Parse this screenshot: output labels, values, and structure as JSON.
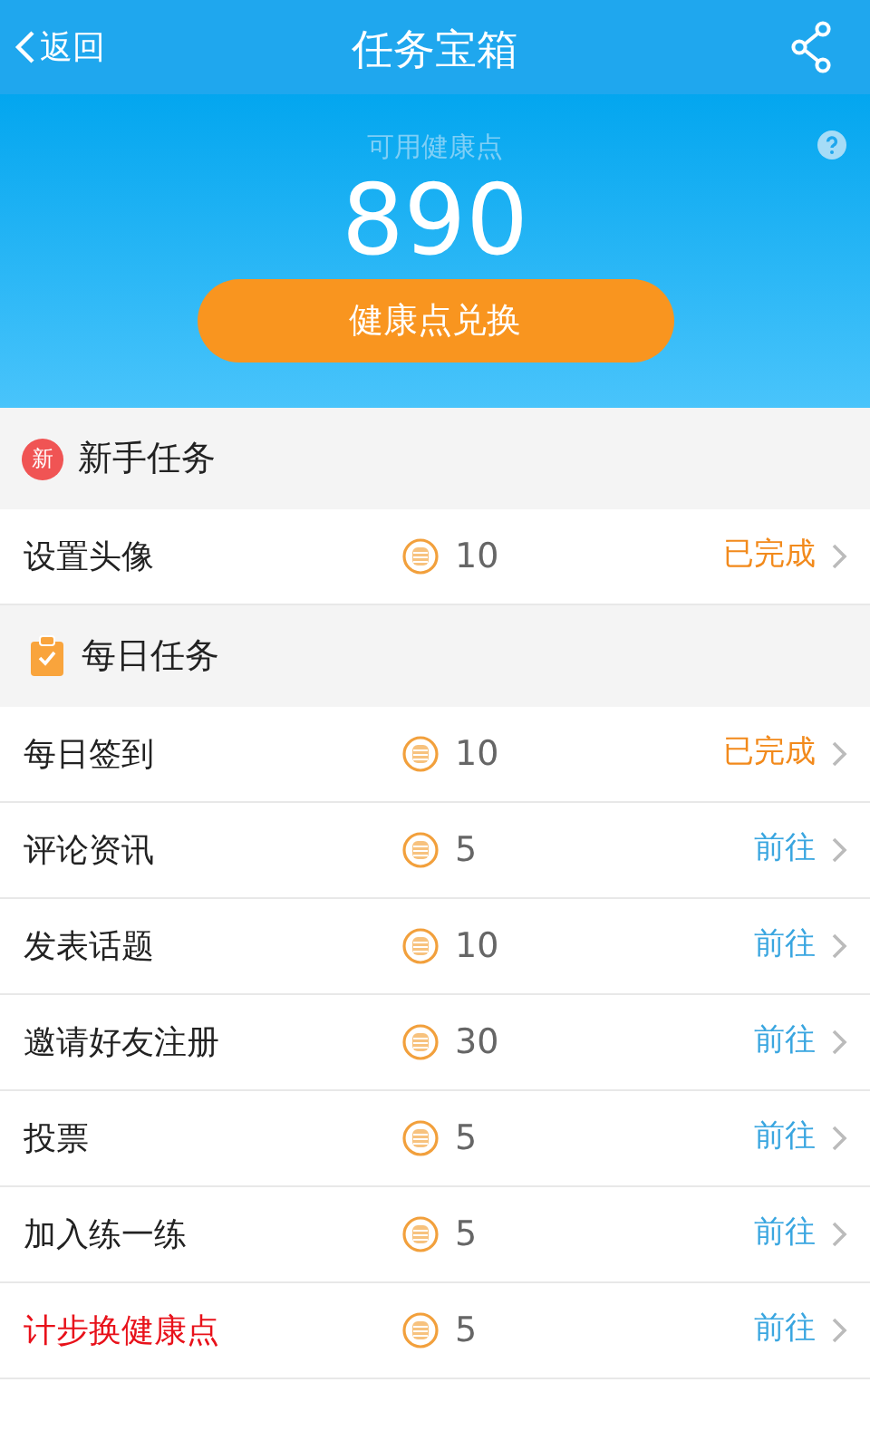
{
  "header": {
    "back": "返回",
    "title": "任务宝箱"
  },
  "balance": {
    "label": "可用健康点",
    "value": "890",
    "button": "健康点兑换"
  },
  "sections": [
    {
      "title": "新手任务",
      "kind": "badge",
      "badge": "新",
      "tasks": [
        {
          "name": "设置头像",
          "points": "10",
          "status": "已完成",
          "kind": "done",
          "highlight": false
        }
      ]
    },
    {
      "title": "每日任务",
      "kind": "clipboard",
      "tasks": [
        {
          "name": "每日签到",
          "points": "10",
          "status": "已完成",
          "kind": "done",
          "highlight": false
        },
        {
          "name": "评论资讯",
          "points": "5",
          "status": "前往",
          "kind": "go",
          "highlight": false
        },
        {
          "name": "发表话题",
          "points": "10",
          "status": "前往",
          "kind": "go",
          "highlight": false
        },
        {
          "name": "邀请好友注册",
          "points": "30",
          "status": "前往",
          "kind": "go",
          "highlight": false
        },
        {
          "name": "投票",
          "points": "5",
          "status": "前往",
          "kind": "go",
          "highlight": false
        },
        {
          "name": "加入练一练",
          "points": "5",
          "status": "前往",
          "kind": "go",
          "highlight": false
        },
        {
          "name": "计步换健康点",
          "points": "5",
          "status": "前往",
          "kind": "go",
          "highlight": true
        }
      ]
    }
  ]
}
